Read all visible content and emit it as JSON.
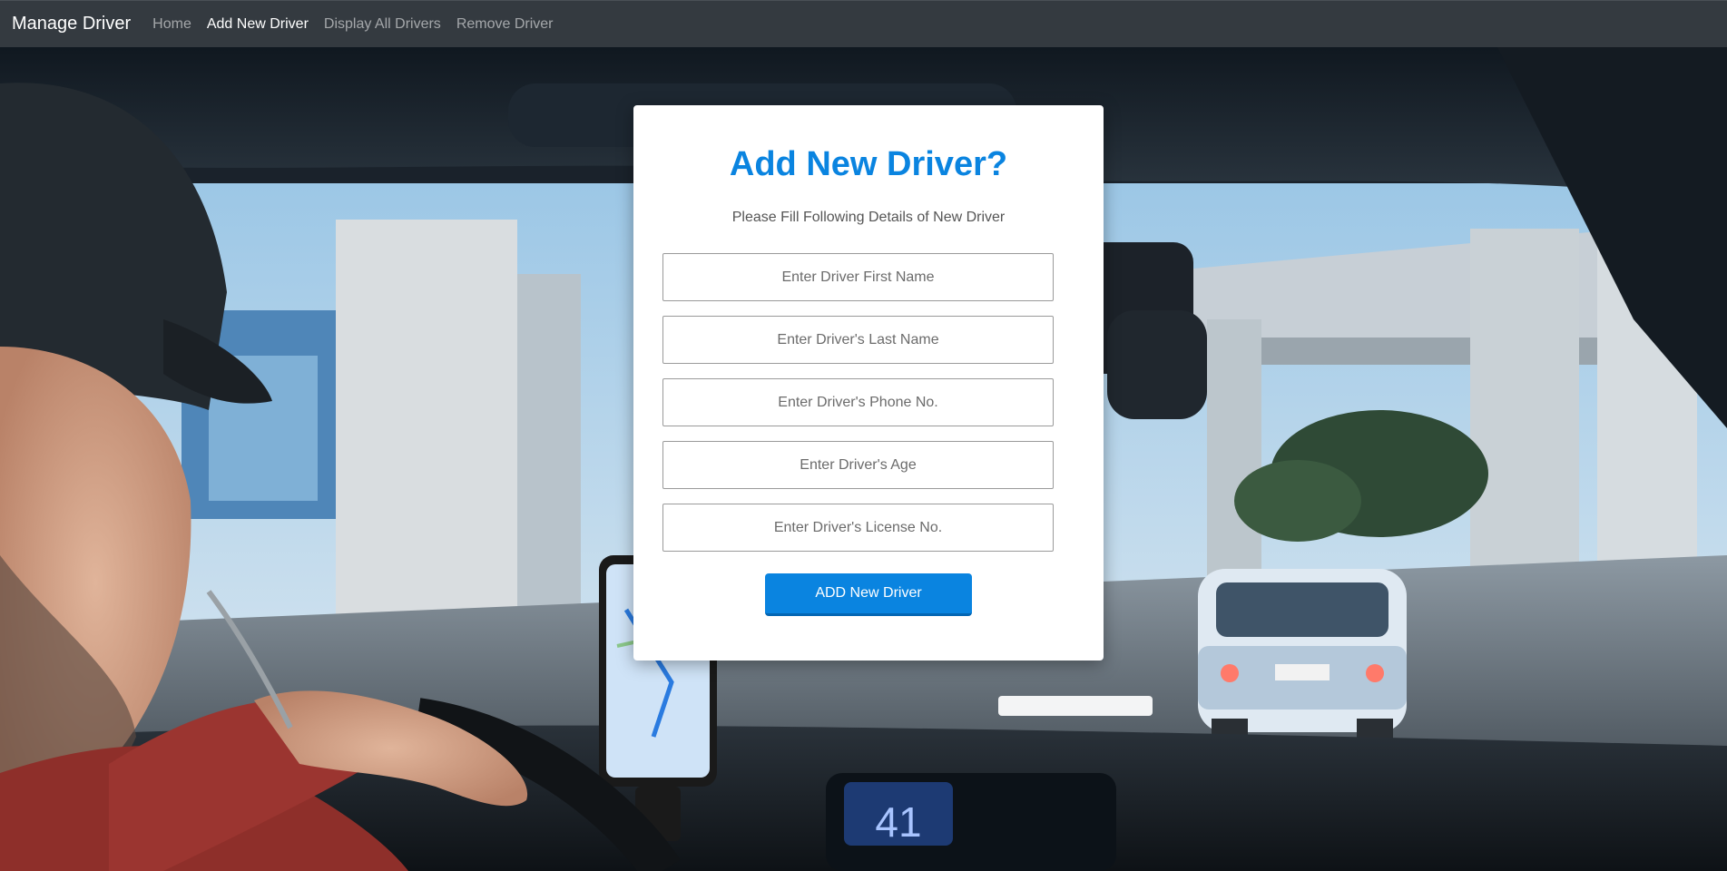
{
  "navbar": {
    "brand": "Manage Driver",
    "links": [
      {
        "label": "Home",
        "active": false
      },
      {
        "label": "Add New Driver",
        "active": true
      },
      {
        "label": "Display All Drivers",
        "active": false
      },
      {
        "label": "Remove Driver",
        "active": false
      }
    ]
  },
  "form": {
    "title": "Add New Driver?",
    "subtitle": "Please Fill Following Details of New Driver",
    "fields": [
      {
        "placeholder": "Enter Driver First Name",
        "value": ""
      },
      {
        "placeholder": "Enter Driver's Last Name",
        "value": ""
      },
      {
        "placeholder": "Enter Driver's Phone No.",
        "value": ""
      },
      {
        "placeholder": "Enter Driver's Age",
        "value": ""
      },
      {
        "placeholder": "Enter Driver's License No.",
        "value": ""
      }
    ],
    "submit_label": "ADD New Driver"
  },
  "background": {
    "dashboard_speed": "41"
  },
  "colors": {
    "navbar_bg": "#343a40",
    "accent": "#0a84e0",
    "nav_active": "#ffffff",
    "nav_inactive": "#9a9da0"
  }
}
